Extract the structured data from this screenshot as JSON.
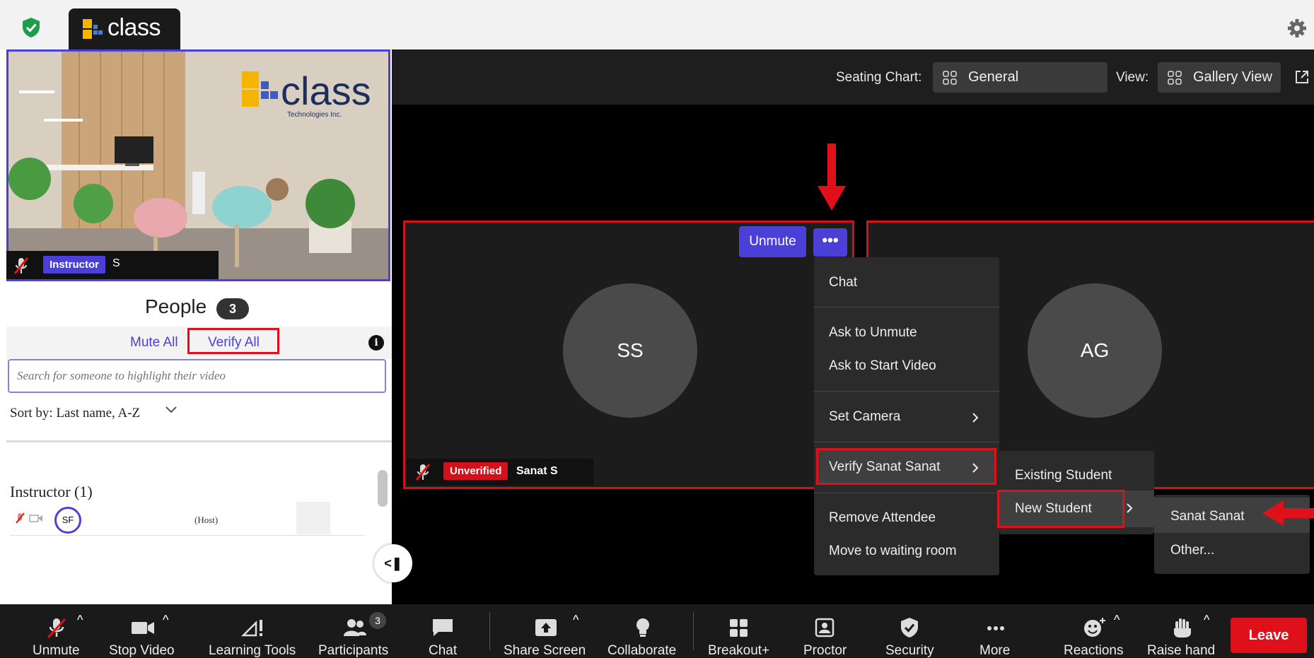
{
  "brand": {
    "name": "class",
    "tagline": "Technologies Inc."
  },
  "instructor_tile": {
    "role_badge": "Instructor",
    "name_fragment": "S"
  },
  "people_panel": {
    "title": "People",
    "count": "3",
    "mute_all": "Mute All",
    "verify_all": "Verify All",
    "search_placeholder": "Search for someone to highlight their video",
    "sort_label": "Sort by:",
    "sort_value": "Last name, A-Z",
    "group_heading": "Instructor (1)",
    "host_initials": "SF",
    "host_tag": "(Host)"
  },
  "seating": {
    "seating_label": "Seating Chart:",
    "seating_value": "General",
    "view_label": "View:",
    "view_value": "Gallery View"
  },
  "tiles": [
    {
      "initials": "SS",
      "status_badge": "Unverified",
      "name_fragment": "Sanat S"
    },
    {
      "initials": "AG"
    }
  ],
  "tile_controls": {
    "unmute": "Unmute",
    "more": "•••"
  },
  "context_menu": {
    "chat": "Chat",
    "ask_unmute": "Ask to Unmute",
    "ask_video": "Ask to Start Video",
    "set_camera": "Set Camera",
    "verify": "Verify Sanat Sanat",
    "remove": "Remove Attendee",
    "waiting_room": "Move to waiting room"
  },
  "verify_submenu": {
    "existing": "Existing Student",
    "new": "New Student"
  },
  "name_submenu": {
    "suggested": "Sanat Sanat",
    "other": "Other..."
  },
  "toolbar": {
    "unmute": "Unmute",
    "stop_video": "Stop Video",
    "learning_tools": "Learning Tools",
    "participants": "Participants",
    "participants_count": "3",
    "chat": "Chat",
    "share_screen": "Share Screen",
    "collaborate": "Collaborate",
    "breakout": "Breakout+",
    "proctor": "Proctor",
    "security": "Security",
    "more": "More",
    "reactions": "Reactions",
    "raise_hand": "Raise hand",
    "leave": "Leave"
  },
  "colors": {
    "accent": "#4a3fd6",
    "highlight_red": "#e0101a",
    "shield_green": "#1e9e4a",
    "toolbar_bg": "#1a1a1a"
  }
}
